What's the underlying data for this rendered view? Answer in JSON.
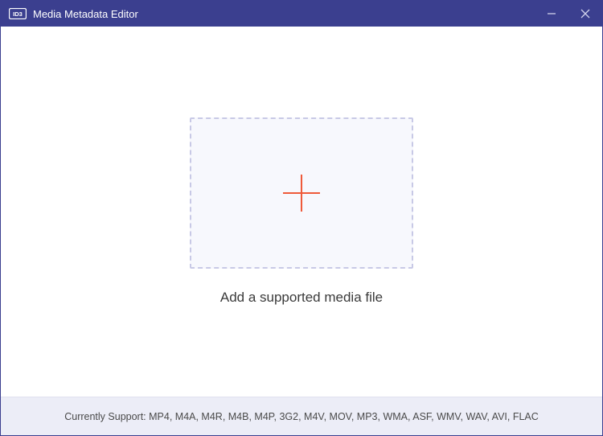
{
  "titlebar": {
    "app_icon_label": "ID3",
    "title": "Media Metadata Editor"
  },
  "main": {
    "prompt": "Add a supported media file"
  },
  "footer": {
    "label": "Currently Support:",
    "formats": "MP4, M4A, M4R, M4B, M4P, 3G2, M4V, MOV, MP3, WMA, ASF, WMV, WAV, AVI, FLAC"
  },
  "colors": {
    "accent": "#3b3f8f",
    "plus": "#ef5a3a",
    "dropzone_border": "#c8c9e6",
    "dropzone_bg": "#f7f8fd",
    "footer_bg": "#ecedf7"
  }
}
